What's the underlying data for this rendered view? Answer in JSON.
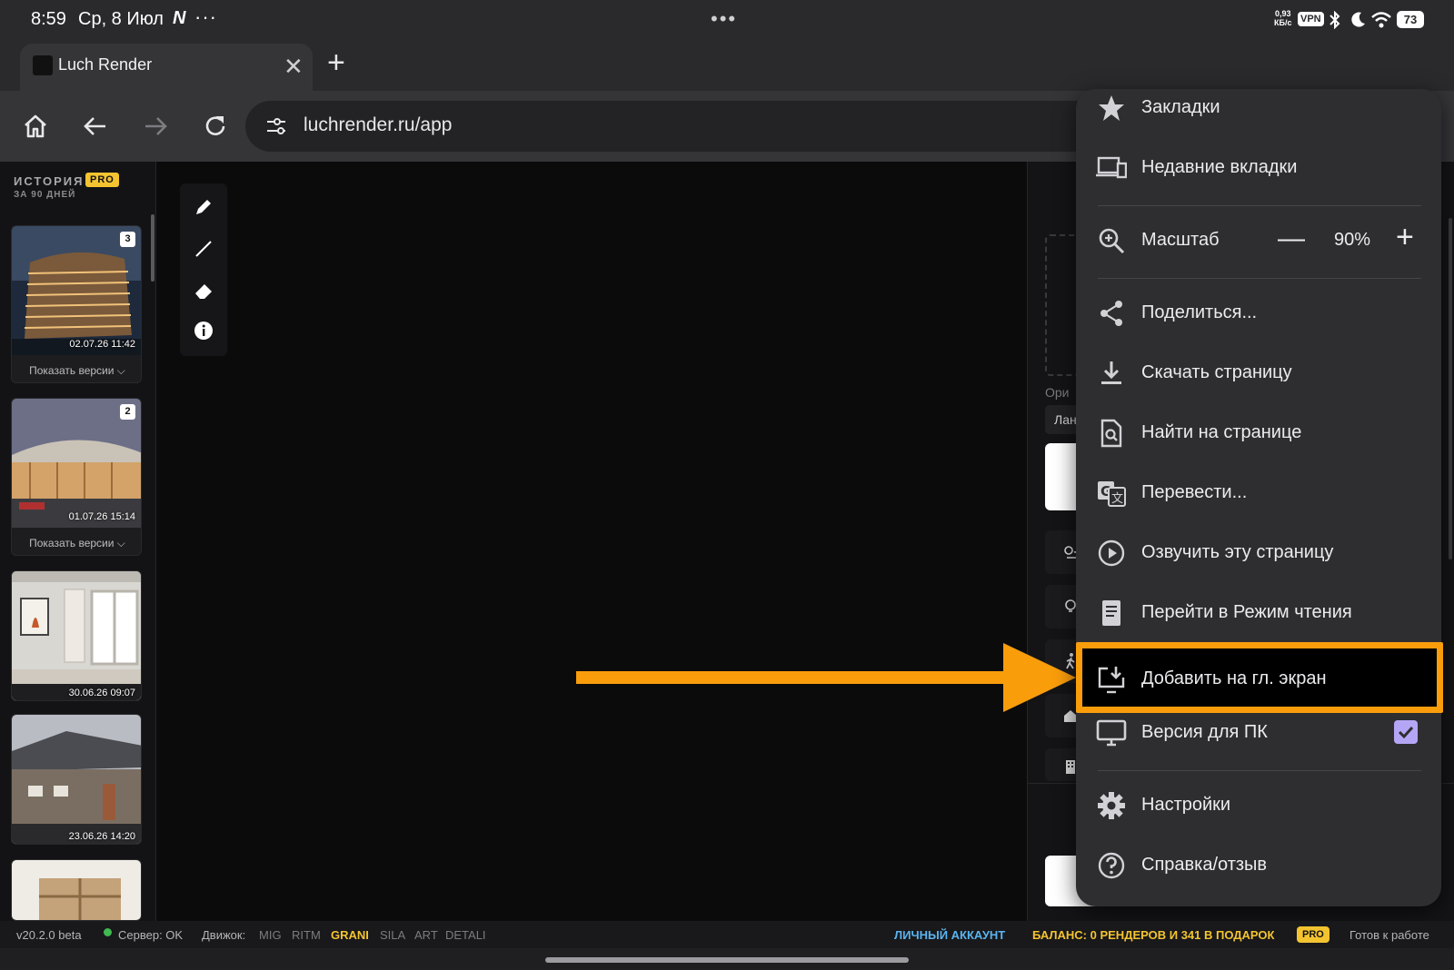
{
  "status_bar": {
    "time": "8:59",
    "date": "Ср, 8 Июл",
    "notification_glyph": "N",
    "more": "···",
    "center_dots": "•••",
    "net_speed_value": "0,93",
    "net_speed_unit": "КБ/с",
    "vpn": "VPN",
    "battery": "73"
  },
  "tab": {
    "title": "Luch Render",
    "close": "✕",
    "new_tab": "+"
  },
  "toolbar": {
    "url": "luchrender.ru/app"
  },
  "sidebar": {
    "title": "ИСТОРИЯ",
    "subtitle": "ЗА 90 ДНЕЙ",
    "pro_badge": "PRO",
    "items": [
      {
        "timestamp": "02.07.26 11:42",
        "count": "3",
        "versions": "Показать версии ⌵"
      },
      {
        "timestamp": "01.07.26 15:14",
        "count": "2",
        "versions": "Показать версии ⌵"
      },
      {
        "timestamp": "30.06.26 09:07"
      },
      {
        "timestamp": "23.06.26 14:20"
      },
      {
        "timestamp": ""
      }
    ]
  },
  "right_panel": {
    "orientation_label": "Ори",
    "orientation_value": "Лан"
  },
  "menu": {
    "items": [
      {
        "label": "Закладки",
        "icon": "star-icon"
      },
      {
        "label": "Недавние вкладки",
        "icon": "devices-icon"
      },
      {
        "label": "Масштаб",
        "icon": "zoom-in-icon"
      },
      {
        "label": "Поделиться...",
        "icon": "share-icon"
      },
      {
        "label": "Скачать страницу",
        "icon": "download-icon"
      },
      {
        "label": "Найти на странице",
        "icon": "find-in-page-icon"
      },
      {
        "label": "Перевести...",
        "icon": "translate-icon"
      },
      {
        "label": "Озвучить эту страницу",
        "icon": "play-circle-icon"
      },
      {
        "label": "Перейти в Режим чтения",
        "icon": "reader-mode-icon"
      },
      {
        "label": "Добавить на гл. экран",
        "icon": "add-to-home-icon"
      },
      {
        "label": "Версия для ПК",
        "icon": "desktop-icon"
      },
      {
        "label": "Настройки",
        "icon": "gear-icon"
      },
      {
        "label": "Справка/отзыв",
        "icon": "help-icon"
      }
    ],
    "zoom": {
      "minus": "—",
      "value": "90%",
      "plus": "+"
    },
    "desktop_checked": true,
    "highlight_color": "#f99d0b"
  },
  "app_status": {
    "version": "v20.2.0 beta",
    "server": "Сервер: OK",
    "engine_label": "Движок:",
    "engines": [
      "MIG",
      "RITM",
      "GRANI",
      "SILA",
      "ART",
      "DETALI"
    ],
    "active_engine": "GRANI",
    "account": "ЛИЧНЫЙ АККАУНТ",
    "balance": "БАЛАНС: 0 РЕНДЕРОВ И 341 В ПОДАРОК",
    "pro": "PRO",
    "ready": "Готов к работе"
  },
  "colors": {
    "accent": "#f99d0b",
    "pro": "#f4c430",
    "server_ok": "#3fb950",
    "account": "#5ab4f0"
  }
}
